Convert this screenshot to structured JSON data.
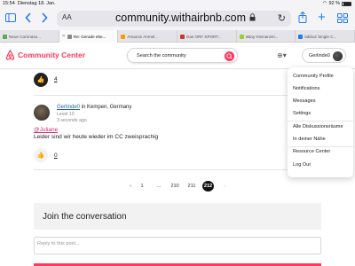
{
  "status_bar": {
    "time": "15:54",
    "date": "Dienstag 18. Jan.",
    "battery": "92 %"
  },
  "browser": {
    "aa_label": "AA",
    "url": "community.withairbnb.com",
    "tabs": [
      {
        "label": "Neue Coronaso...",
        "color": "#4caf50"
      },
      {
        "label": "Re: Gerade ebe...",
        "color": "#888888"
      },
      {
        "label": "Amazon Anmel...",
        "color": "#ff9900"
      },
      {
        "label": "Das ORF SPORT...",
        "color": "#d32f2f"
      },
      {
        "label": "eBay Kleinanzei...",
        "color": "#9acd32"
      },
      {
        "label": "labbuz Single C...",
        "color": "#1f7aec"
      }
    ]
  },
  "header": {
    "logo_text": "Community Center",
    "search_placeholder": "Search the community",
    "username": "Gerlinde0"
  },
  "thread": {
    "prev_like_count": "4",
    "post": {
      "author": "Gerlinde0",
      "location": " in Kempen, Germany",
      "level": "Level 10",
      "time": "3 seconds ago",
      "mention": "@Juliane",
      "body": "Leider sind wir heute wieder im CC zweisprachig",
      "like_count": "0"
    }
  },
  "pagination": {
    "prev": "‹",
    "next": "›",
    "pages": [
      "1",
      "...",
      "210",
      "211",
      "212"
    ],
    "current": "212"
  },
  "join": {
    "title": "Join the conversation",
    "reply_placeholder": "Reply to this post..."
  },
  "user_menu": {
    "items": [
      "Community Profile",
      "Notifications",
      "Messages",
      "Settings",
      "Alle Diskussionsräume",
      "In deiner Nähe",
      "Resource Center",
      "Log Out"
    ]
  },
  "colors": {
    "brand": "#ff385c",
    "ios_accent": "#1f7aec"
  }
}
